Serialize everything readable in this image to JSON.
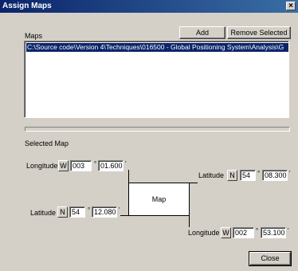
{
  "window": {
    "title": "Assign Maps",
    "close_glyph": "×"
  },
  "maps_section": {
    "label": "Maps",
    "add_label": "Add",
    "remove_label": "Remove Selected",
    "items": [
      "C:\\Source code\\Version 4\\Techniques\\016500 - Global Positioning System\\Analysis\\G"
    ]
  },
  "selected_map": {
    "label": "Selected Map",
    "map_label": "Map",
    "top_left_lon": {
      "label": "Longitude",
      "dir": "W",
      "deg": "003",
      "deg_sym": "°",
      "min": "01.600",
      "min_sym": "'"
    },
    "top_right_lat": {
      "label": "Latitude",
      "dir": "N",
      "deg": "54",
      "deg_sym": "°",
      "min": "08.300",
      "min_sym": "'"
    },
    "bottom_left_lat": {
      "label": "Latitude",
      "dir": "N",
      "deg": "54",
      "deg_sym": "°",
      "min": "12.080",
      "min_sym": "'"
    },
    "bottom_right_lon": {
      "label": "Longitude",
      "dir": "W",
      "deg": "002",
      "deg_sym": "°",
      "min": "53.100",
      "min_sym": "'"
    }
  },
  "footer": {
    "close_label": "Close"
  },
  "colors": {
    "face": "#d4d0c8",
    "title_start": "#0a246a",
    "title_end": "#3a6ea5",
    "selection": "#0a246a"
  }
}
